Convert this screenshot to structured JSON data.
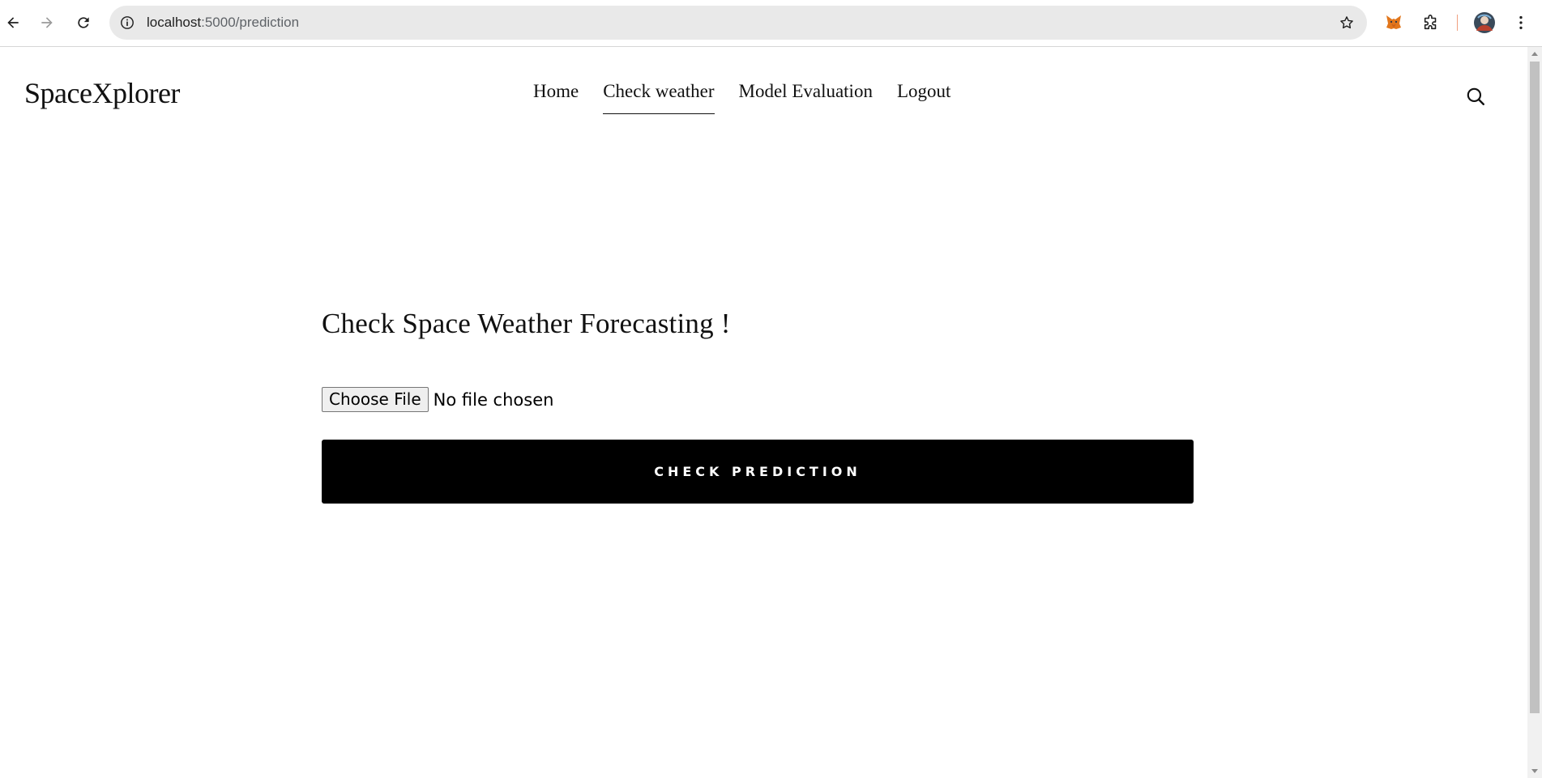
{
  "browser": {
    "url_host": "localhost",
    "url_path": ":5000/prediction",
    "icons": {
      "back": "back-arrow-icon",
      "forward": "forward-arrow-icon",
      "reload": "reload-icon",
      "site_info": "info-icon",
      "bookmark": "star-icon",
      "extension_metamask": "fox-icon",
      "extensions": "puzzle-icon",
      "profile": "avatar",
      "menu": "kebab-menu-icon"
    }
  },
  "site": {
    "logo": "SpaceXplorer",
    "nav": [
      {
        "label": "Home",
        "active": false
      },
      {
        "label": "Check weather",
        "active": true
      },
      {
        "label": "Model Evaluation",
        "active": false
      },
      {
        "label": "Logout",
        "active": false
      }
    ],
    "search_icon": "search-icon"
  },
  "main": {
    "heading": "Check Space Weather Forecasting !",
    "file_button": "Choose File",
    "file_status": "No file chosen",
    "submit_label": "CHECK PREDICTION"
  },
  "colors": {
    "button_bg": "#000000",
    "button_text": "#ffffff",
    "page_bg": "#ffffff"
  }
}
